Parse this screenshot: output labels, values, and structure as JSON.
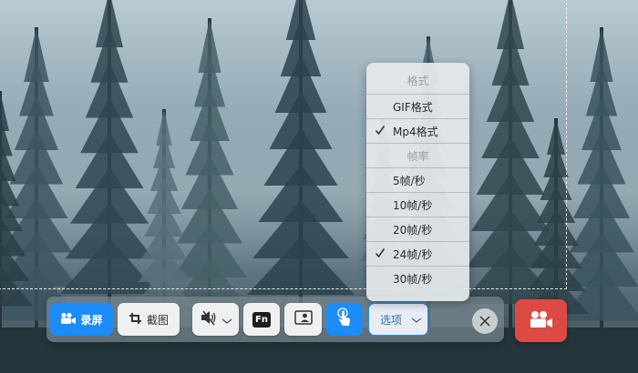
{
  "toolbar": {
    "record_label": "录屏",
    "screenshot_label": "截图",
    "fn_label": "Fn",
    "options_label": "选项"
  },
  "menu": {
    "items": [
      {
        "label": "格式",
        "type": "header",
        "checked": false
      },
      {
        "label": "GIF格式",
        "type": "option",
        "checked": false
      },
      {
        "label": "Mp4格式",
        "type": "option",
        "checked": true
      },
      {
        "label": "帧率",
        "type": "header",
        "checked": false
      },
      {
        "label": "5帧/秒",
        "type": "option",
        "checked": false
      },
      {
        "label": "10帧/秒",
        "type": "option",
        "checked": false
      },
      {
        "label": "20帧/秒",
        "type": "option",
        "checked": false
      },
      {
        "label": "24帧/秒",
        "type": "option",
        "checked": true
      },
      {
        "label": "30帧/秒",
        "type": "option",
        "checked": false
      }
    ]
  },
  "icons": {
    "record": "video-camera-icon",
    "screenshot": "crop-icon",
    "audio": "speaker-muted-icon",
    "camera": "webcam-icon",
    "cursor": "touch-pointer-icon",
    "close": "close-icon",
    "start": "start-recording-icon"
  },
  "colors": {
    "accent": "#1b8cf8",
    "start": "#dd4a44"
  }
}
